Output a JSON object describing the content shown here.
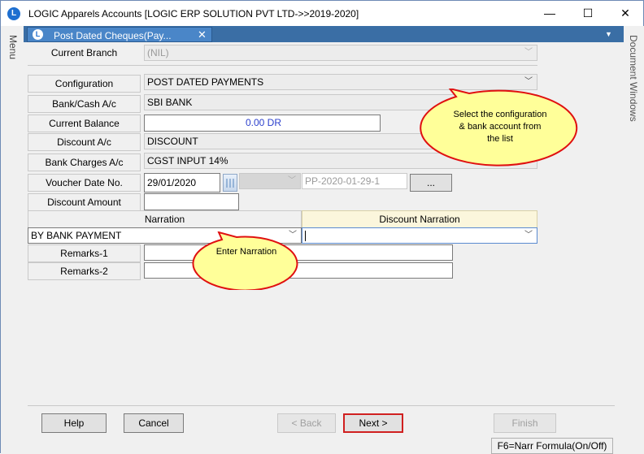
{
  "window": {
    "title": "LOGIC Apparels Accounts  [LOGIC ERP SOLUTION PVT LTD->>2019-2020]",
    "minimize": "—",
    "maximize": "☐",
    "close": "✕"
  },
  "side": {
    "left_label": "Menu",
    "right_label": "Document Windows"
  },
  "tab": {
    "label": "Post Dated Cheques(Pay...",
    "close": "✕"
  },
  "form": {
    "current_branch_label": "Current Branch",
    "current_branch_value": "(NIL)",
    "configuration_label": "Configuration",
    "configuration_value": "POST DATED PAYMENTS",
    "bank_cash_label": "Bank/Cash A/c",
    "bank_cash_value": "SBI BANK",
    "current_balance_label": "Current Balance",
    "current_balance_value": "0.00 DR",
    "discount_ac_label": "Discount A/c",
    "discount_ac_value": "DISCOUNT",
    "bank_charges_label": "Bank Charges A/c",
    "bank_charges_value": "CGST INPUT 14%",
    "voucher_label": "Voucher Date  No.",
    "voucher_date": "29/01/2020",
    "voucher_no": "PP-2020-01-29-1",
    "ellipsis": "...",
    "discount_amount_label": "Discount Amount",
    "narration_header": "Narration",
    "discount_narration_header": "Discount Narration",
    "narration_value": "BY BANK PAYMENT",
    "remarks1_label": "Remarks-1",
    "remarks2_label": "Remarks-2"
  },
  "callouts": {
    "config_tip_line1": "Select  the  configuration",
    "config_tip_line2": "&  bank  account  from",
    "config_tip_line3": "the  list",
    "narration_tip": "Enter  Narration"
  },
  "buttons": {
    "help": "Help",
    "cancel": "Cancel",
    "back": "< Back",
    "next": "Next >",
    "finish": "Finish"
  },
  "status": {
    "text": "F6=Narr Formula(On/Off)"
  },
  "colors": {
    "tab_bg": "#4a86c8",
    "callout_fill": "#ffff99",
    "callout_stroke": "#e01010",
    "highlight": "#d02020"
  }
}
